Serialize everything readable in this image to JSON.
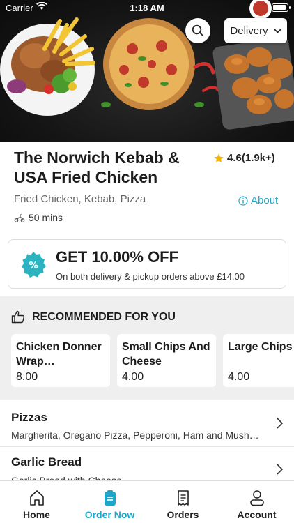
{
  "status_bar": {
    "carrier": "Carrier",
    "time": "1:18 AM"
  },
  "header": {
    "delivery_mode": "Delivery"
  },
  "restaurant": {
    "name": "The Norwich Kebab & USA Fried Chicken",
    "rating": "4.6",
    "rating_count": "(1.9k+)",
    "cuisines": "Fried Chicken, Kebab, Pizza",
    "about_label": "About",
    "eta": "50 mins"
  },
  "offer": {
    "title": "GET 10.00% OFF",
    "subtitle": "On both delivery & pickup orders above £14.00"
  },
  "recommended": {
    "heading": "RECOMMENDED FOR YOU",
    "items": [
      {
        "name": "Chicken Donner Wrap…",
        "price": "8.00"
      },
      {
        "name": "Small Chips And Cheese",
        "price": "4.00"
      },
      {
        "name": "Large Chips",
        "price": "4.00"
      }
    ]
  },
  "categories": [
    {
      "title": "Pizzas",
      "items": "Margherita, Oregano Pizza, Pepperoni, Ham and Mush…"
    },
    {
      "title": "Garlic Bread",
      "items": "Garlic Bread with Cheese"
    }
  ],
  "tabs": [
    {
      "label": "Home"
    },
    {
      "label": "Order Now"
    },
    {
      "label": "Orders"
    },
    {
      "label": "Account"
    }
  ],
  "colors": {
    "accent": "#1ea6c9",
    "star": "#f5b400",
    "offer_badge": "#2bb3c0"
  }
}
